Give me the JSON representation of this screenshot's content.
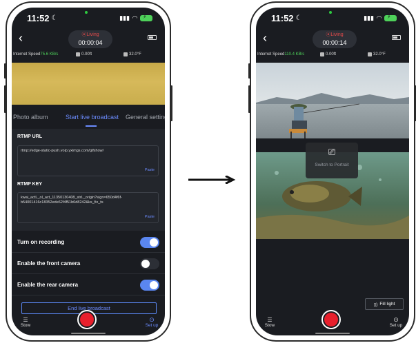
{
  "left_phone": {
    "status": {
      "time": "11:52"
    },
    "header": {
      "living": "⦿Living",
      "timer": "00:00:04"
    },
    "info": {
      "speed_label": "Internet Speed",
      "speed_value": "75.6 KB/s",
      "depth": "0.00ft",
      "temp": "32.0°F"
    },
    "tabs": [
      {
        "label": "Photo album"
      },
      {
        "label": "Start live broadcast"
      },
      {
        "label": "General settings"
      }
    ],
    "rtmp_url": {
      "label": "RTMP URL",
      "value": "rtmp://edge-static-push.voip.yximgs.com/gifshow/",
      "paste": "Paste"
    },
    "rtmp_key": {
      "label": "RTMP KEY",
      "value": "kwai_actL_ol_act_11350130408_strL_origin?sign=650d4f6f-b54001416c18352ede62f4f51b6d8242&ks_fix_ts",
      "paste": "Paste"
    },
    "toggles": [
      {
        "label": "Turn on recording",
        "on": true
      },
      {
        "label": "Enable the front camera",
        "on": false
      },
      {
        "label": "Enable the rear camera",
        "on": true
      }
    ],
    "end_button": "End live broadcast",
    "bottom": {
      "stow": "Stow",
      "setup": "Set up"
    }
  },
  "right_phone": {
    "status": {
      "time": "11:52"
    },
    "header": {
      "living": "⦿Living",
      "timer": "00:00:14"
    },
    "info": {
      "speed_label": "Internet Speed",
      "speed_value": "110.4 KB/s",
      "depth": "0.00ft",
      "temp": "32.0°F"
    },
    "rotate_popup": "Switch to Portrait",
    "fill_light": "Fill light",
    "bottom": {
      "stow": "Stow",
      "setup": "Set up"
    }
  },
  "colors": {
    "accent": "#5a86f0",
    "recording": "#e81f2c",
    "speed_green": "#4ed15a"
  }
}
